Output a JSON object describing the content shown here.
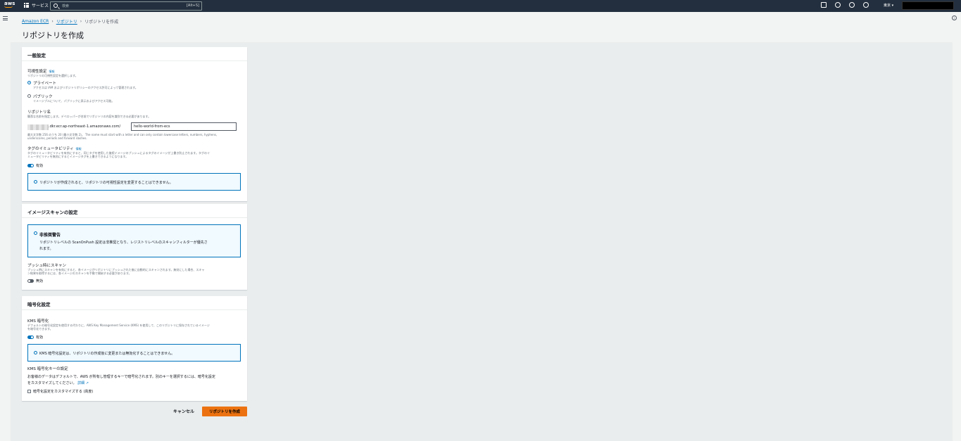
{
  "topbar": {
    "logo": "aws",
    "services_label": "サービス",
    "search_placeholder": "検索",
    "search_shortcut": "[Alt+S]",
    "region_label": "東京 ▾"
  },
  "breadcrumb": [
    "Amazon ECR",
    "リポジトリ",
    "リポジトリを作成"
  ],
  "page_title": "リポジトリを作成",
  "general": {
    "title": "一般設定",
    "visibility_label": "可視性設定",
    "info": "情報",
    "visibility_desc": "リポジトリの可視性設定を選択します。",
    "private_label": "プライベート",
    "private_desc": "アクセスは IAM およびリポジトリポリシーのアクセス許可によって管理されます。",
    "public_label": "パブリック",
    "public_desc": "イメージプルについて、パブリックに表示およびアクセス可能。",
    "repo_name_label": "リポジトリ名",
    "repo_name_desc": "簡潔な名前を指定します。デベロッパーが名前でリポジトリの内容を識別できる必要があります。",
    "repo_prefix": ".dkr.ecr.ap-northeast-1.amazonaws.com/",
    "repo_name_value": "hello-world-from-ecs",
    "repo_name_hint_1": "最大文字数 256 のうち 20 (最小文字数 2)。 The name must start with a letter and can only contain lowercase letters, numbers, hyphens,",
    "repo_name_hint_2": "underscores, periods and forward slashes.",
    "tag_label": "タグのイミュータビリティ",
    "tag_desc_1": "タグのイミュータビリティを有効にすると、同じタグを使用した後続イメージのプッシュによるタグのイメージが上書き防止されます。タグのイ",
    "tag_desc_2": "ミュータビリティを無効にするとイメージタグを上書きできるようになります。",
    "tag_toggle": "有効",
    "alert": "リポジトリが作成されると、リポジトリの可視性設定を変更することはできません。"
  },
  "scan": {
    "title": "イメージスキャンの設定",
    "warn_title": "非推奨警告",
    "warn_text_1": "リポジトリレベルの ScanOnPush 設定は非推奨となり、レジストリレベルのスキャンフィルターが優先さ",
    "warn_text_2": "れます。",
    "push_label": "プッシュ時にスキャン",
    "push_desc_1": "プッシュ時にスキャンを有効にすると、各イメージがリポジトリにプッシュされた後に自動的にスキャンされます。無効にした場合、スキャ",
    "push_desc_2": "ン結果を取得するには、各イメージのスキャンを手動で開始する必要があります。",
    "push_toggle": "無効"
  },
  "encryption": {
    "title": "暗号化設定",
    "kms_label": "KMS 暗号化",
    "kms_desc_1": "デフォルトの暗号化設定を使用する代わりに、AWS Key Management Service (KMS) を使用して、このリポジトリに保存されているイメージ",
    "kms_desc_2": "を暗号化できます。",
    "kms_toggle": "有効",
    "alert": "KMS 暗号化設定は、リポジトリの作成後に変更または無効化することはできません。",
    "key_label": "KMS 暗号化キーの設定",
    "key_desc_1": "お客様のデータはデフォルトで、AWS が所有し管理するキーで暗号化されます。別のキーを選択するには、暗号化設定",
    "key_desc_2": "をカスタマイズしてください。",
    "details_link": "詳細 ↗",
    "customize_label": "暗号化設定をカスタマイズする (高度)"
  },
  "actions": {
    "cancel": "キャンセル",
    "create": "リポジトリを作成"
  }
}
